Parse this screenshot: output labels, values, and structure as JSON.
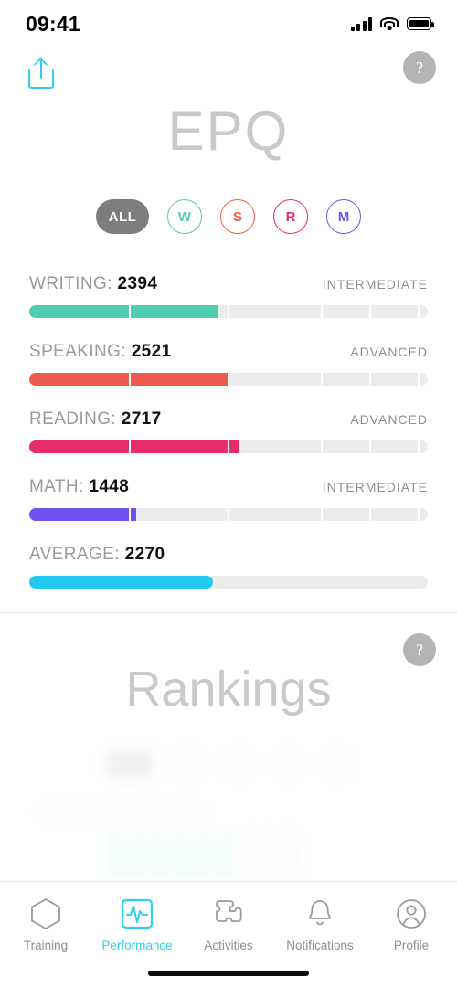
{
  "status_bar": {
    "time": "09:41",
    "signal_icon": "cellular-bars-icon",
    "wifi_icon": "wifi-icon",
    "battery_icon": "battery-full-icon"
  },
  "header": {
    "share_icon": "share-icon",
    "help_label": "?",
    "title": "EPQ"
  },
  "filters": [
    {
      "id": "all",
      "label": "ALL",
      "color": "#7d7d7d",
      "active": true
    },
    {
      "id": "writing",
      "label": "W",
      "color": "#4ecdb0",
      "active": false
    },
    {
      "id": "speaking",
      "label": "S",
      "color": "#ec5b4b",
      "active": false
    },
    {
      "id": "reading",
      "label": "R",
      "color": "#e82a6f",
      "active": false
    },
    {
      "id": "math",
      "label": "M",
      "color": "#6f51ef",
      "active": false
    }
  ],
  "scores": [
    {
      "name": "WRITING",
      "label": "WRITING:",
      "value": "2394",
      "level": "INTERMEDIATE",
      "color": "#4ecdb0",
      "percent": 48,
      "segmented": true
    },
    {
      "name": "SPEAKING",
      "label": "SPEAKING:",
      "value": "2521",
      "level": "ADVANCED",
      "color": "#ec5b4b",
      "percent": 50.5,
      "segmented": true
    },
    {
      "name": "READING",
      "label": "READING:",
      "value": "2717",
      "level": "ADVANCED",
      "color": "#e82a6f",
      "percent": 53,
      "segmented": true
    },
    {
      "name": "MATH",
      "label": "MATH:",
      "value": "1448",
      "level": "INTERMEDIATE",
      "color": "#6f51ef",
      "percent": 27,
      "segmented": true
    },
    {
      "name": "AVERAGE",
      "label": "AVERAGE:",
      "value": "2270",
      "level": "",
      "color": "#20c9f0",
      "percent": 46,
      "segmented": false
    }
  ],
  "rankings": {
    "title": "Rankings",
    "help_label": "?"
  },
  "tabs": [
    {
      "id": "training",
      "label": "Training",
      "icon": "hexagon-icon",
      "active": false
    },
    {
      "id": "performance",
      "label": "Performance",
      "icon": "pulse-icon",
      "active": true
    },
    {
      "id": "activities",
      "label": "Activities",
      "icon": "puzzle-piece-icon",
      "active": false
    },
    {
      "id": "notifications",
      "label": "Notifications",
      "icon": "bell-icon",
      "active": false
    },
    {
      "id": "profile",
      "label": "Profile",
      "icon": "person-icon",
      "active": false
    }
  ],
  "chart_data": {
    "type": "bar",
    "title": "EPQ",
    "categories": [
      "WRITING",
      "SPEAKING",
      "READING",
      "MATH",
      "AVERAGE"
    ],
    "values": [
      2394,
      2521,
      2717,
      1448,
      2270
    ],
    "levels": [
      "INTERMEDIATE",
      "ADVANCED",
      "ADVANCED",
      "INTERMEDIATE",
      ""
    ],
    "percents": [
      48,
      50.5,
      53,
      27,
      46
    ],
    "colors": [
      "#4ecdb0",
      "#ec5b4b",
      "#e82a6f",
      "#6f51ef",
      "#20c9f0"
    ],
    "xlabel": "",
    "ylabel": "",
    "ylim": [
      0,
      5000
    ],
    "orientation": "horizontal",
    "grid": false,
    "legend": false
  },
  "segment_stops": [
    25.5,
    50.5,
    74,
    86,
    98,
    100
  ]
}
